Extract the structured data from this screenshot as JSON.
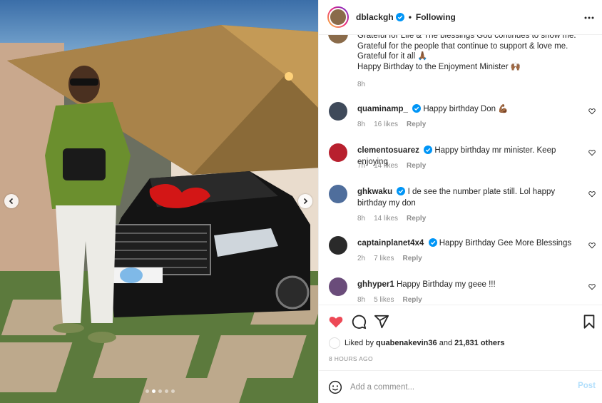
{
  "post": {
    "username": "dblackgh",
    "follow_status": "Following",
    "separator": "•"
  },
  "caption": {
    "lines": [
      "Grateful for Life & The blessings God continues to show me.",
      "Grateful for the people that continue to support & love me.",
      "Grateful for it all 🙏🏾",
      "Happy Birthday to the Enjoyment Minister 🙌🏾"
    ],
    "time": "8h"
  },
  "comments": [
    {
      "user": "quaminamp_",
      "verified": true,
      "text": "Happy birthday Don 💪🏾",
      "time": "8h",
      "likes": "16 likes",
      "reply": "Reply"
    },
    {
      "user": "clementosuarez",
      "verified": true,
      "text": "Happy birthday mr minister. Keep enjoying",
      "time": "7h",
      "likes": "14 likes",
      "reply": "Reply"
    },
    {
      "user": "ghkwaku",
      "verified": true,
      "text": "I de see the number plate still. Lol happy birthday my don",
      "time": "8h",
      "likes": "14 likes",
      "reply": "Reply"
    },
    {
      "user": "captainplanet4x4",
      "verified": true,
      "text": "Happy Birthday Gee More Blessings",
      "time": "2h",
      "likes": "7 likes",
      "reply": "Reply"
    },
    {
      "user": "ghhyper1",
      "verified": false,
      "text": "Happy Birthday my geee !!!",
      "time": "8h",
      "likes": "5 likes",
      "reply": "Reply"
    }
  ],
  "likes": {
    "prefix": "Liked by",
    "user": "quabenakevin36",
    "middle": "and",
    "count": "21,831 others"
  },
  "post_time": "8 HOURS AGO",
  "add_comment": {
    "placeholder": "Add a comment...",
    "post_label": "Post"
  },
  "carousel": {
    "slide_count": 5,
    "active_index": 1
  },
  "colors": {
    "verified": "#0095f6",
    "heart_liked": "#ed4956",
    "post_disabled": "#b2dffc",
    "muted": "#8e8e8e"
  },
  "icons": [
    "verified-badge-icon",
    "more-options-icon",
    "heart-icon",
    "comment-icon",
    "share-icon",
    "bookmark-icon",
    "emoji-icon",
    "chevron-left-icon",
    "chevron-right-icon"
  ]
}
